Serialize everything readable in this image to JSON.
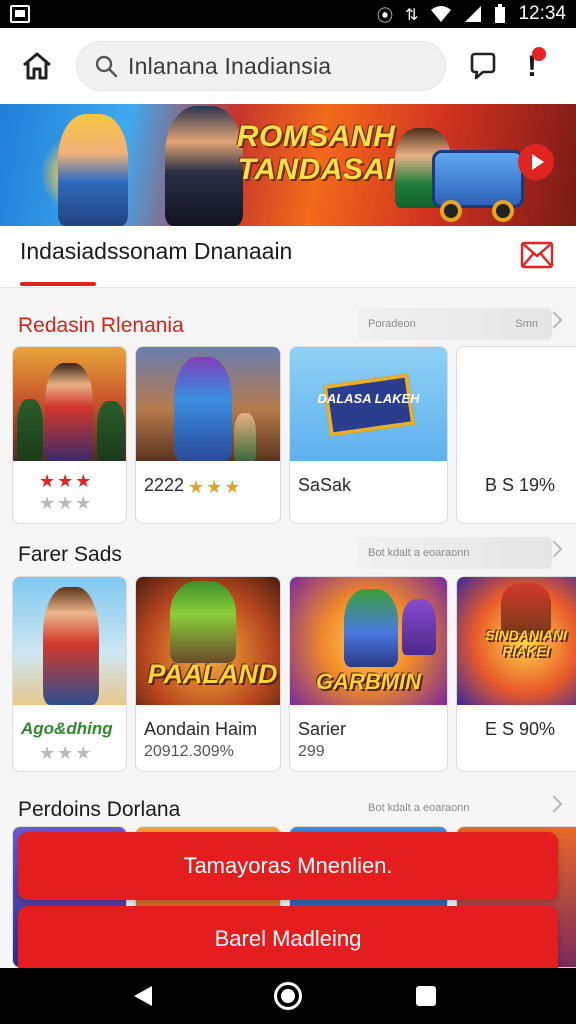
{
  "status_bar": {
    "time": "12:34"
  },
  "header": {
    "search_text": "Inlanana Inadiansia"
  },
  "banner": {
    "title_line1": "ROMSANH",
    "title_line2": "TANDASAI"
  },
  "tab": {
    "label": "Indasiadssonam Dnanaain"
  },
  "section1": {
    "title": "Redasin Rlenania",
    "see_more_a": "Poradeon",
    "see_more_b": "Smn",
    "cards": [
      {
        "label": "",
        "rating": "★★★",
        "stars_off": "★★★"
      },
      {
        "label": "2222",
        "rating": "★★★"
      },
      {
        "label": "SaSak",
        "logo": "DALASA LAKEH"
      },
      {
        "label": "B S 19%"
      }
    ]
  },
  "section2": {
    "title": "Farer Sads",
    "see_more": "Bot kdalt a eoaraonn",
    "cards": [
      {
        "label": "Ago&dhing",
        "stars_off": "★★★"
      },
      {
        "label": "Aondain Haim",
        "sub": "20912.309%",
        "logo": "PAALAND"
      },
      {
        "label": "Sarier",
        "sub": "299",
        "logo": "GARBMIN"
      },
      {
        "label": "E S 90%",
        "logo": "SINDANIANI RIAKEI"
      }
    ]
  },
  "section3": {
    "title": "Perdoins Dorlana",
    "see_more": "Bot kdalt a eoaraonn"
  },
  "buttons": {
    "primary": "Tamayoras Mnenlien.",
    "secondary": "Barel Madleing"
  },
  "colors": {
    "accent": "#e41e1e",
    "section_red": "#d3231f"
  }
}
